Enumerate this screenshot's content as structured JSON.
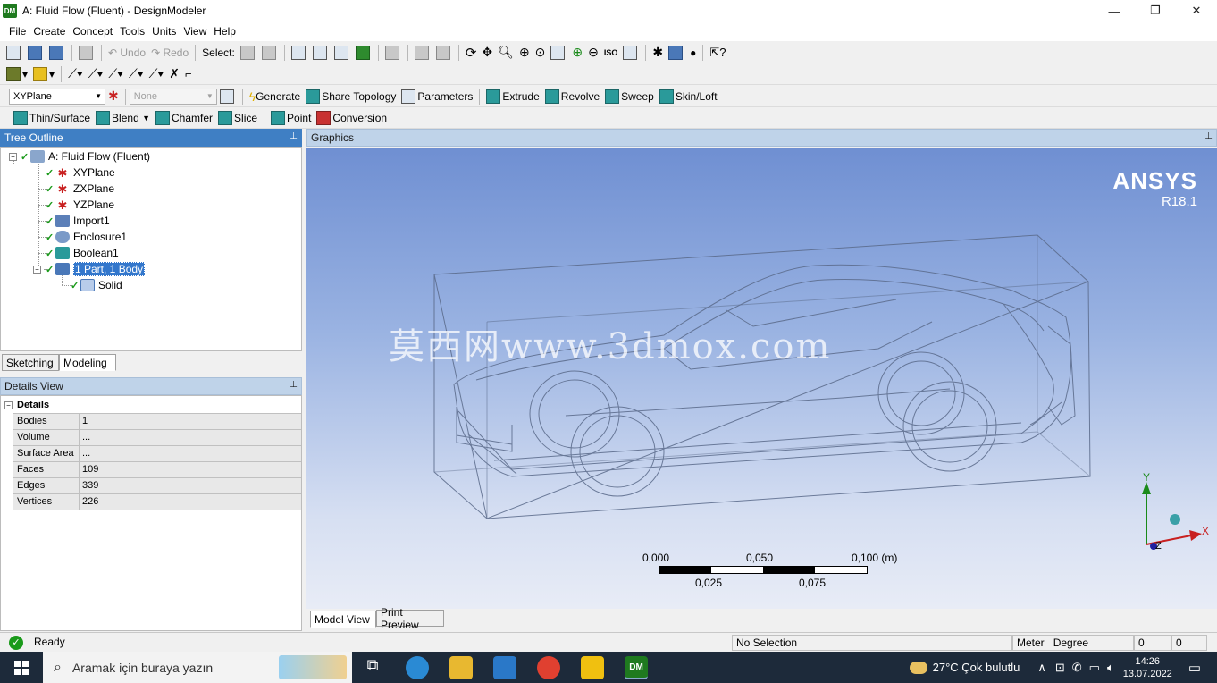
{
  "window": {
    "title": "A: Fluid Flow (Fluent) - DesignModeler",
    "app_icon_text": "DM",
    "minimize": "—",
    "maximize": "❐",
    "close": "✕"
  },
  "menu": [
    "File",
    "Create",
    "Concept",
    "Tools",
    "Units",
    "View",
    "Help"
  ],
  "toolbar1": {
    "undo": "Undo",
    "redo": "Redo",
    "select_label": "Select:"
  },
  "toolbar3": {
    "plane_value": "XYPlane",
    "sketch_value": "None",
    "generate": "Generate",
    "share_topology": "Share Topology",
    "parameters": "Parameters",
    "extrude": "Extrude",
    "revolve": "Revolve",
    "sweep": "Sweep",
    "skin_loft": "Skin/Loft"
  },
  "toolbar4": {
    "thin_surface": "Thin/Surface",
    "blend": "Blend",
    "chamfer": "Chamfer",
    "slice": "Slice",
    "point": "Point",
    "conversion": "Conversion"
  },
  "tree": {
    "header": "Tree Outline",
    "root": "A: Fluid Flow (Fluent)",
    "items": [
      "XYPlane",
      "ZXPlane",
      "YZPlane",
      "Import1",
      "Enclosure1",
      "Boolean1",
      "1 Part, 1 Body"
    ],
    "child": "Solid"
  },
  "left_tabs": [
    "Sketching",
    "Modeling"
  ],
  "details": {
    "header": "Details View",
    "group": "Details",
    "rows": [
      {
        "k": "Bodies",
        "v": "1"
      },
      {
        "k": "Volume",
        "v": "..."
      },
      {
        "k": "Surface Area",
        "v": "..."
      },
      {
        "k": "Faces",
        "v": "109"
      },
      {
        "k": "Edges",
        "v": "339"
      },
      {
        "k": "Vertices",
        "v": "226"
      }
    ]
  },
  "graphics": {
    "header": "Graphics",
    "logo": "ANSYS",
    "version": "R18.1",
    "watermark": "莫西网www.3dmox.com",
    "scale_top": [
      "0,000",
      "0,050",
      "0,100 (m)"
    ],
    "scale_bottom": [
      "0,025",
      "0,075"
    ],
    "axis_x": "X",
    "axis_y": "Y",
    "axis_z": "Z"
  },
  "bottom_tabs": [
    "Model View",
    "Print Preview"
  ],
  "status": {
    "ready": "Ready",
    "selection": "No Selection",
    "units_length": "Meter",
    "units_angle": "Degree",
    "val1": "0",
    "val2": "0"
  },
  "taskbar": {
    "search_placeholder": "Aramak için buraya yazın",
    "weather": "27°C  Çok bulutlu",
    "time": "14:26",
    "date": "13.07.2022",
    "dm_label": "DM"
  },
  "colors": {
    "accent": "#3f7fc4",
    "check_green": "#1a9a1a",
    "viewport_top": "#6f8fd2",
    "viewport_bottom": "#e8ecf6"
  }
}
